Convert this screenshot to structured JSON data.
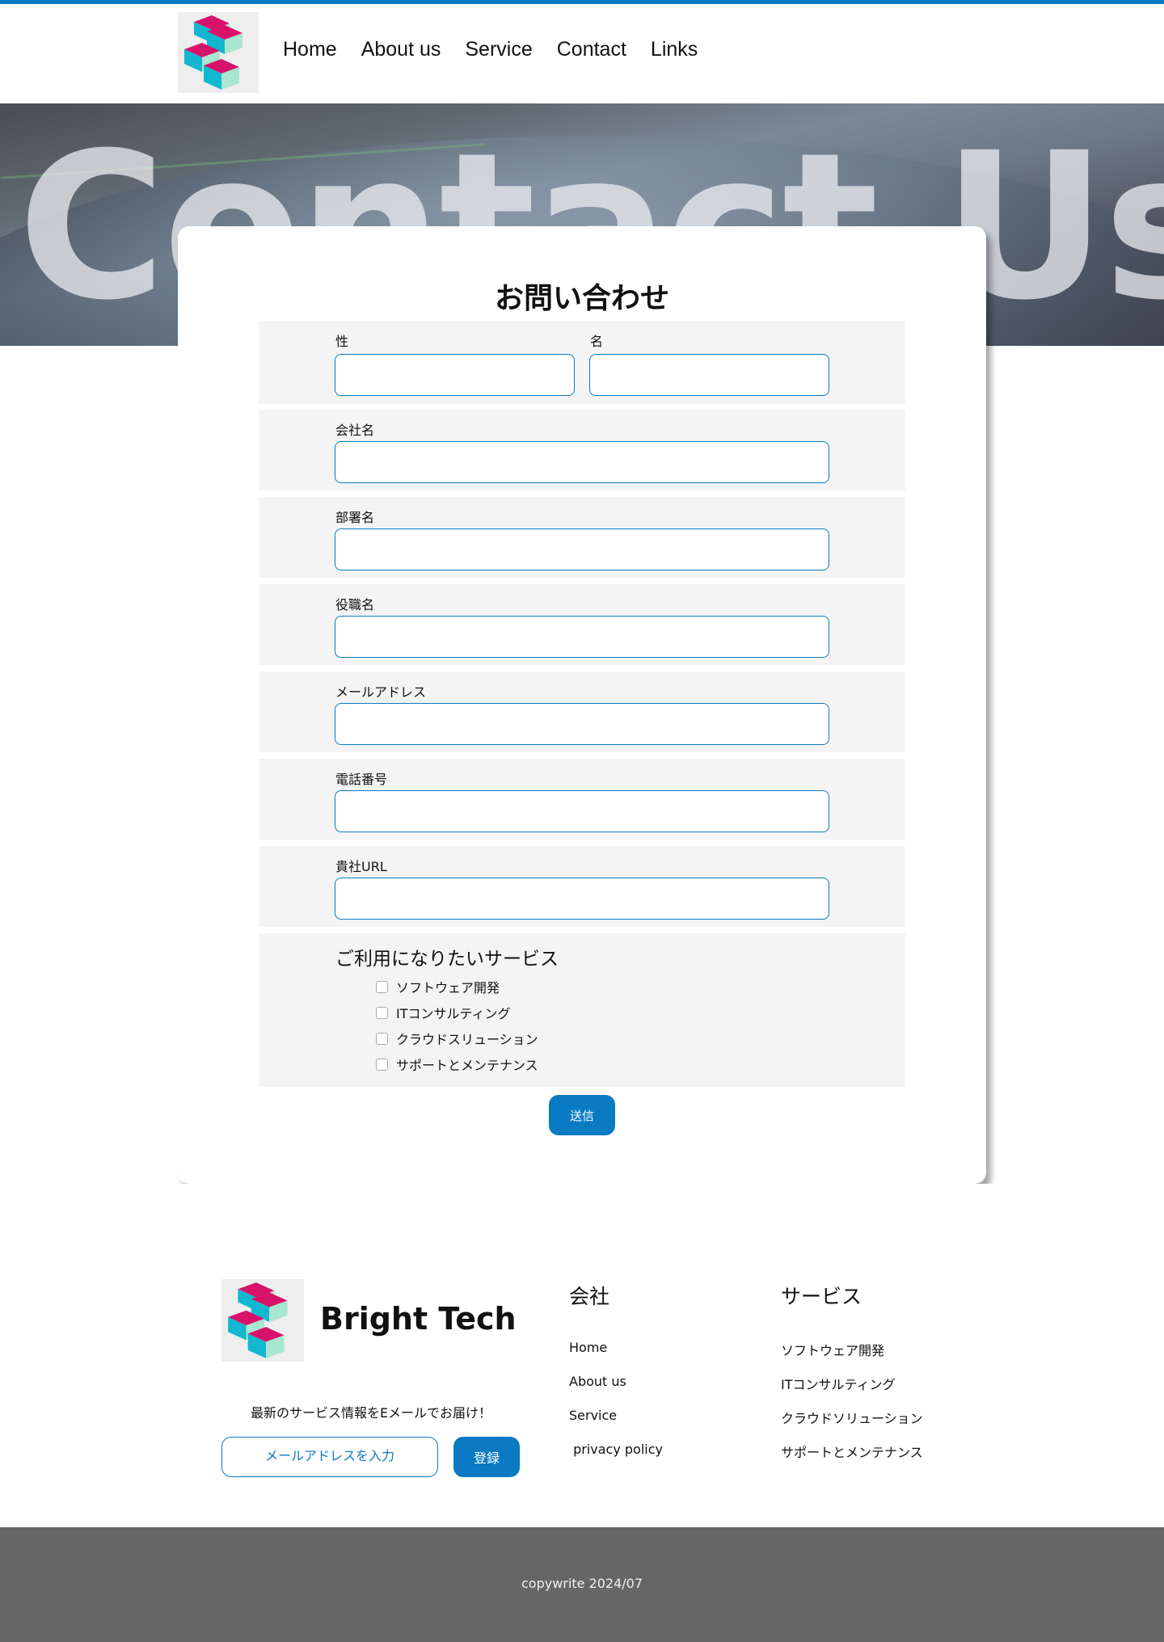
{
  "brand": {
    "name": "Bright Tech",
    "colors": {
      "accent": "#0a7bc2",
      "logo_pink": "#d8126a",
      "logo_cyan": "#12b7d0",
      "logo_mint": "#a8e6cf"
    }
  },
  "nav": {
    "items": [
      {
        "label": "Home"
      },
      {
        "label": "About us"
      },
      {
        "label": "Service"
      },
      {
        "label": "Contact"
      },
      {
        "label": "Links"
      }
    ]
  },
  "hero": {
    "bg_text": "Contact Us"
  },
  "form": {
    "title": "お問い合わせ",
    "last_name": {
      "label": "性",
      "value": ""
    },
    "first_name": {
      "label": "名",
      "value": ""
    },
    "fields": [
      {
        "label": "会社名",
        "value": ""
      },
      {
        "label": "部署名",
        "value": ""
      },
      {
        "label": "役職名",
        "value": ""
      },
      {
        "label": "メールアドレス",
        "value": ""
      },
      {
        "label": "電話番号",
        "value": ""
      },
      {
        "label": "貴社URL",
        "value": ""
      }
    ],
    "services_title": "ご利用になりたいサービス",
    "services": [
      {
        "label": "ソフトウェア開発",
        "checked": false
      },
      {
        "label": "ITコンサルティング",
        "checked": false
      },
      {
        "label": "クラウドスリューション",
        "checked": false
      },
      {
        "label": "サポートとメンテナンス",
        "checked": false
      }
    ],
    "submit_label": "送信"
  },
  "footer": {
    "promo_text": "最新のサービス情報をEメールでお届け！",
    "email_placeholder": "メールアドレスを入力",
    "subscribe_label": "登録",
    "company_title": "会社",
    "company_links": [
      "Home",
      "About us",
      "Service",
      " privacy policy"
    ],
    "service_title": "サービス",
    "service_links": [
      "ソフトウェア開発",
      "ITコンサルティング",
      "クラウドソリューション",
      "サポートとメンテナンス"
    ],
    "copyright": "copywrite 2024/07"
  }
}
